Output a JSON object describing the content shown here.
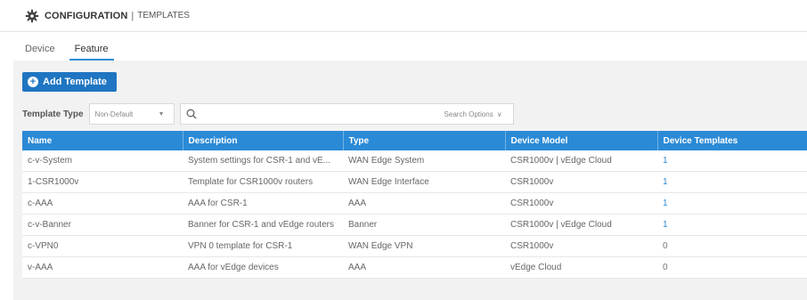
{
  "header": {
    "section": "CONFIGURATION",
    "separator": "|",
    "page": "TEMPLATES"
  },
  "tabs": [
    {
      "label": "Device",
      "active": false
    },
    {
      "label": "Feature",
      "active": true
    }
  ],
  "toolbar": {
    "add_label": "Add Template"
  },
  "filter": {
    "template_type_label": "Template Type",
    "template_type_value": "Non-Default",
    "search_value": "",
    "search_options_label": "Search Options"
  },
  "table": {
    "columns": [
      "Name",
      "Description",
      "Type",
      "Device Model",
      "Device Templates"
    ],
    "rows": [
      {
        "name": "c-v-System",
        "description": "System settings for CSR-1 and vE...",
        "type": "WAN Edge System",
        "device_model": "CSR1000v | vEdge Cloud",
        "device_templates": "1"
      },
      {
        "name": "1-CSR1000v",
        "description": "Template for CSR1000v routers",
        "type": "WAN Edge Interface",
        "device_model": "CSR1000v",
        "device_templates": "1"
      },
      {
        "name": "c-AAA",
        "description": "AAA for CSR-1",
        "type": "AAA",
        "device_model": "CSR1000v",
        "device_templates": "1"
      },
      {
        "name": "c-v-Banner",
        "description": "Banner for CSR-1 and vEdge routers",
        "type": "Banner",
        "device_model": "CSR1000v | vEdge Cloud",
        "device_templates": "1"
      },
      {
        "name": "c-VPN0",
        "description": "VPN 0 template for CSR-1",
        "type": "WAN Edge VPN",
        "device_model": "CSR1000v",
        "device_templates": "0"
      },
      {
        "name": "v-AAA",
        "description": "AAA for vEdge devices",
        "type": "AAA",
        "device_model": "vEdge Cloud",
        "device_templates": "0"
      }
    ]
  },
  "colors": {
    "accent": "#2b8ad6",
    "button": "#1f75c1"
  }
}
